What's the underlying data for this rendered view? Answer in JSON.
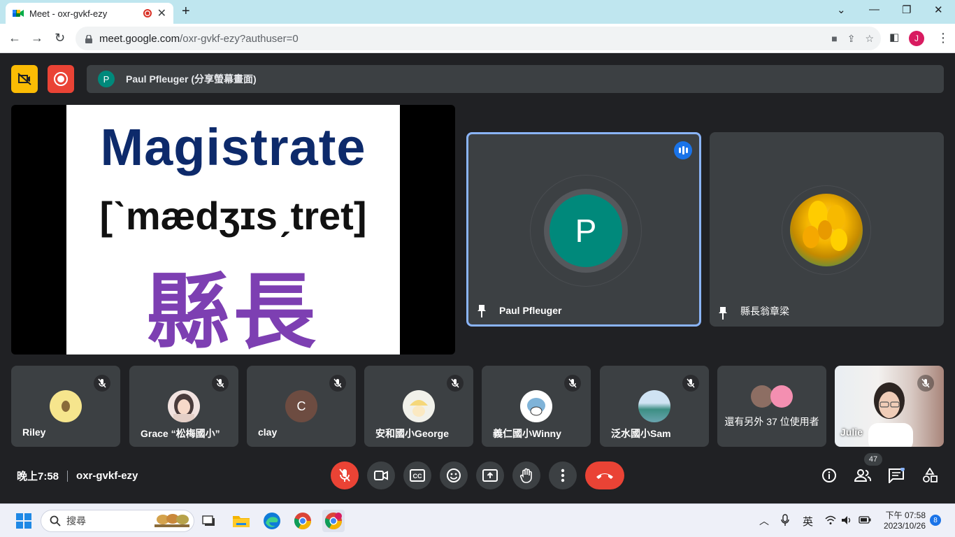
{
  "browser": {
    "tab_title": "Meet - oxr-gvkf-ezy",
    "url_host": "meet.google.com",
    "url_path": "/oxr-gvkf-ezy?authuser=0",
    "profile_initial": "J"
  },
  "meet": {
    "presenter_initial": "P",
    "presenter_label": "Paul Pfleuger (分享螢幕畫面)",
    "slide": {
      "word": "Magistrate",
      "ipa": "[ˋmædʒɪsˏtret]",
      "chinese": "縣長"
    },
    "main_tiles": [
      {
        "name": "Paul Pfleuger",
        "initial": "P"
      },
      {
        "name": "縣長翁章梁"
      }
    ],
    "participants": [
      {
        "name": "Riley"
      },
      {
        "name": "Grace “松梅國小”"
      },
      {
        "name": "clay",
        "initial": "C"
      },
      {
        "name": "安和國小George"
      },
      {
        "name": "義仁國小Winny"
      },
      {
        "name": "泛水國小Sam"
      },
      {
        "name": "Julie"
      }
    ],
    "others_label": "還有另外 37 位使用者",
    "time": "晚上7:58",
    "meeting_code": "oxr-gvkf-ezy",
    "participant_count": "47"
  },
  "taskbar": {
    "search_placeholder": "搜尋",
    "ime": "英",
    "clock_time": "下午 07:58",
    "clock_date": "2023/10/26",
    "notification_count": "8"
  }
}
